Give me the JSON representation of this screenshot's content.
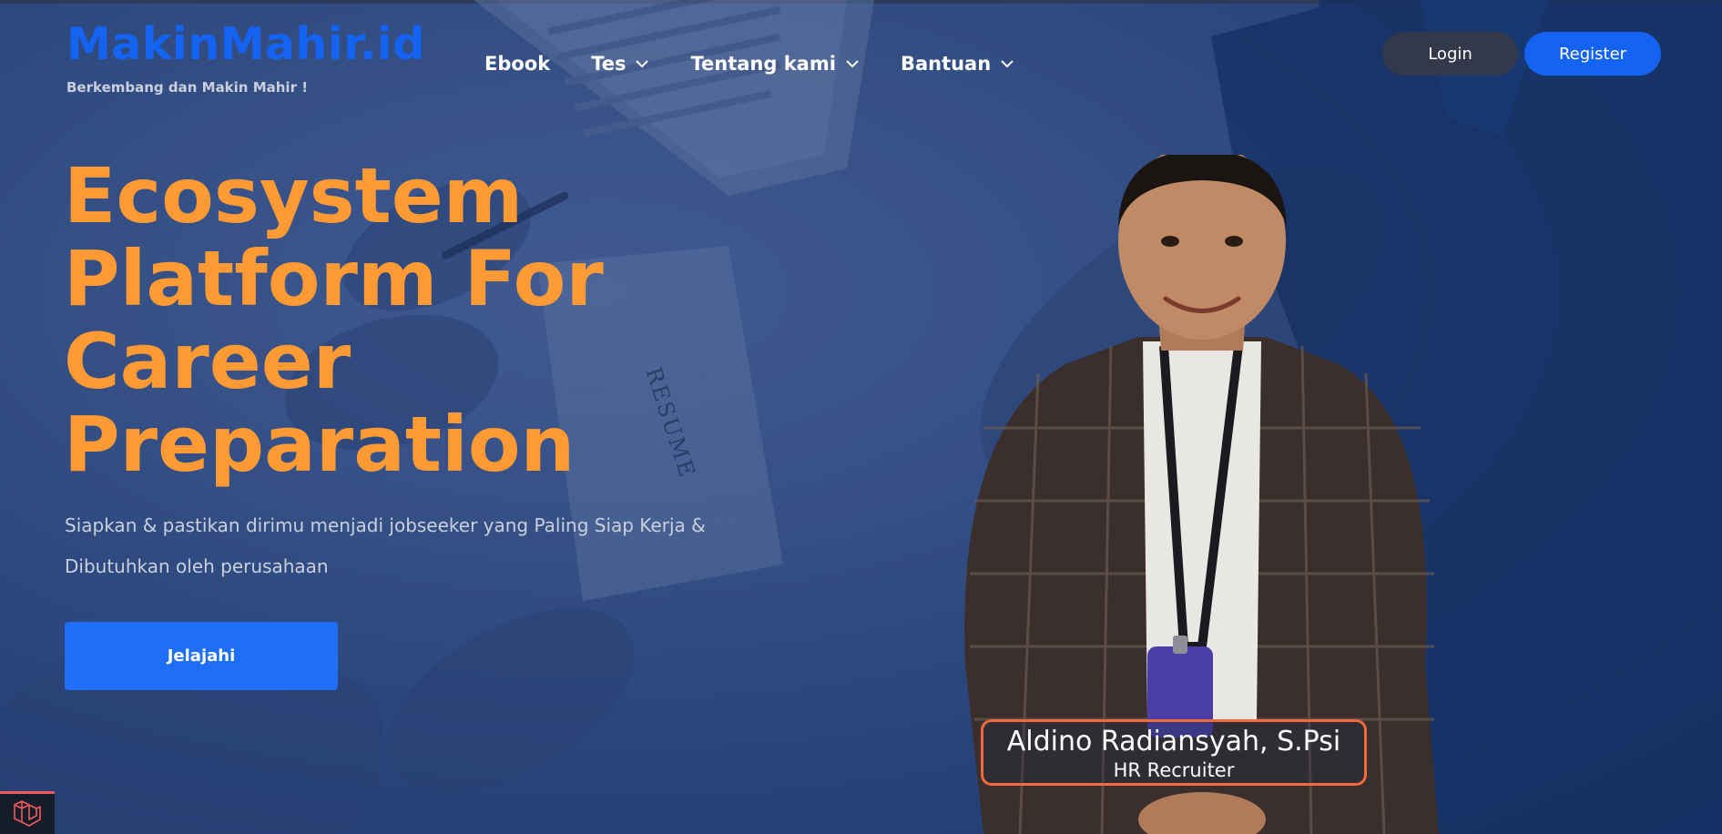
{
  "brand": {
    "logo_text": "MakinMahir.id",
    "tagline": "Berkembang dan Makin Mahir !",
    "logo_color": "#1463f3"
  },
  "nav": {
    "items": [
      {
        "label": "Ebook",
        "has_dropdown": false
      },
      {
        "label": "Tes",
        "has_dropdown": true
      },
      {
        "label": "Tentang kami",
        "has_dropdown": true
      },
      {
        "label": "Bantuan",
        "has_dropdown": true
      }
    ]
  },
  "auth": {
    "login_label": "Login",
    "register_label": "Register"
  },
  "hero": {
    "title_lines": [
      "Ecosystem",
      "Platform For",
      "Career",
      "Preparation"
    ],
    "subtitle": "Siapkan & pastikan dirimu menjadi jobseeker yang Paling Siap Kerja & Dibutuhkan oleh perusahaan",
    "cta_label": "Jelajahi",
    "title_color": "#ff9a34",
    "cta_color": "#1f6ef8"
  },
  "featured_person": {
    "name": "Aldino Radiansyah, S.Psi",
    "role": "HR Recruiter",
    "card_border_color": "#f36a3c"
  },
  "background_text": {
    "resume_label": "RESUME"
  },
  "icons": {
    "corner_badge": "laravel-icon",
    "dropdown": "chevron-down-icon"
  }
}
